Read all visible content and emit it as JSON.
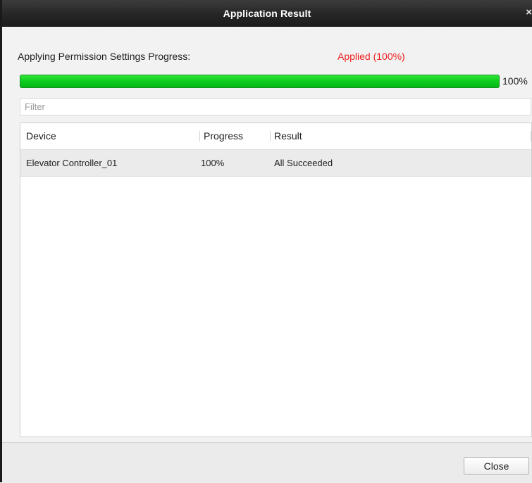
{
  "dialog": {
    "title": "Application Result",
    "close_glyph": "×"
  },
  "progress": {
    "label": "Applying Permission Settings Progress:",
    "status": "Applied (100%)",
    "status_color": "#ee2222",
    "value_percent": 100,
    "percent_text": "100%",
    "fill_color": "#0fcf1e"
  },
  "filter": {
    "placeholder": "Filter",
    "value": ""
  },
  "table": {
    "columns": [
      "Device",
      "Progress",
      "Result"
    ],
    "rows": [
      {
        "device": "Elevator Controller_01",
        "progress": "100%",
        "result": "All Succeeded"
      }
    ]
  },
  "footer": {
    "close_label": "Close"
  }
}
